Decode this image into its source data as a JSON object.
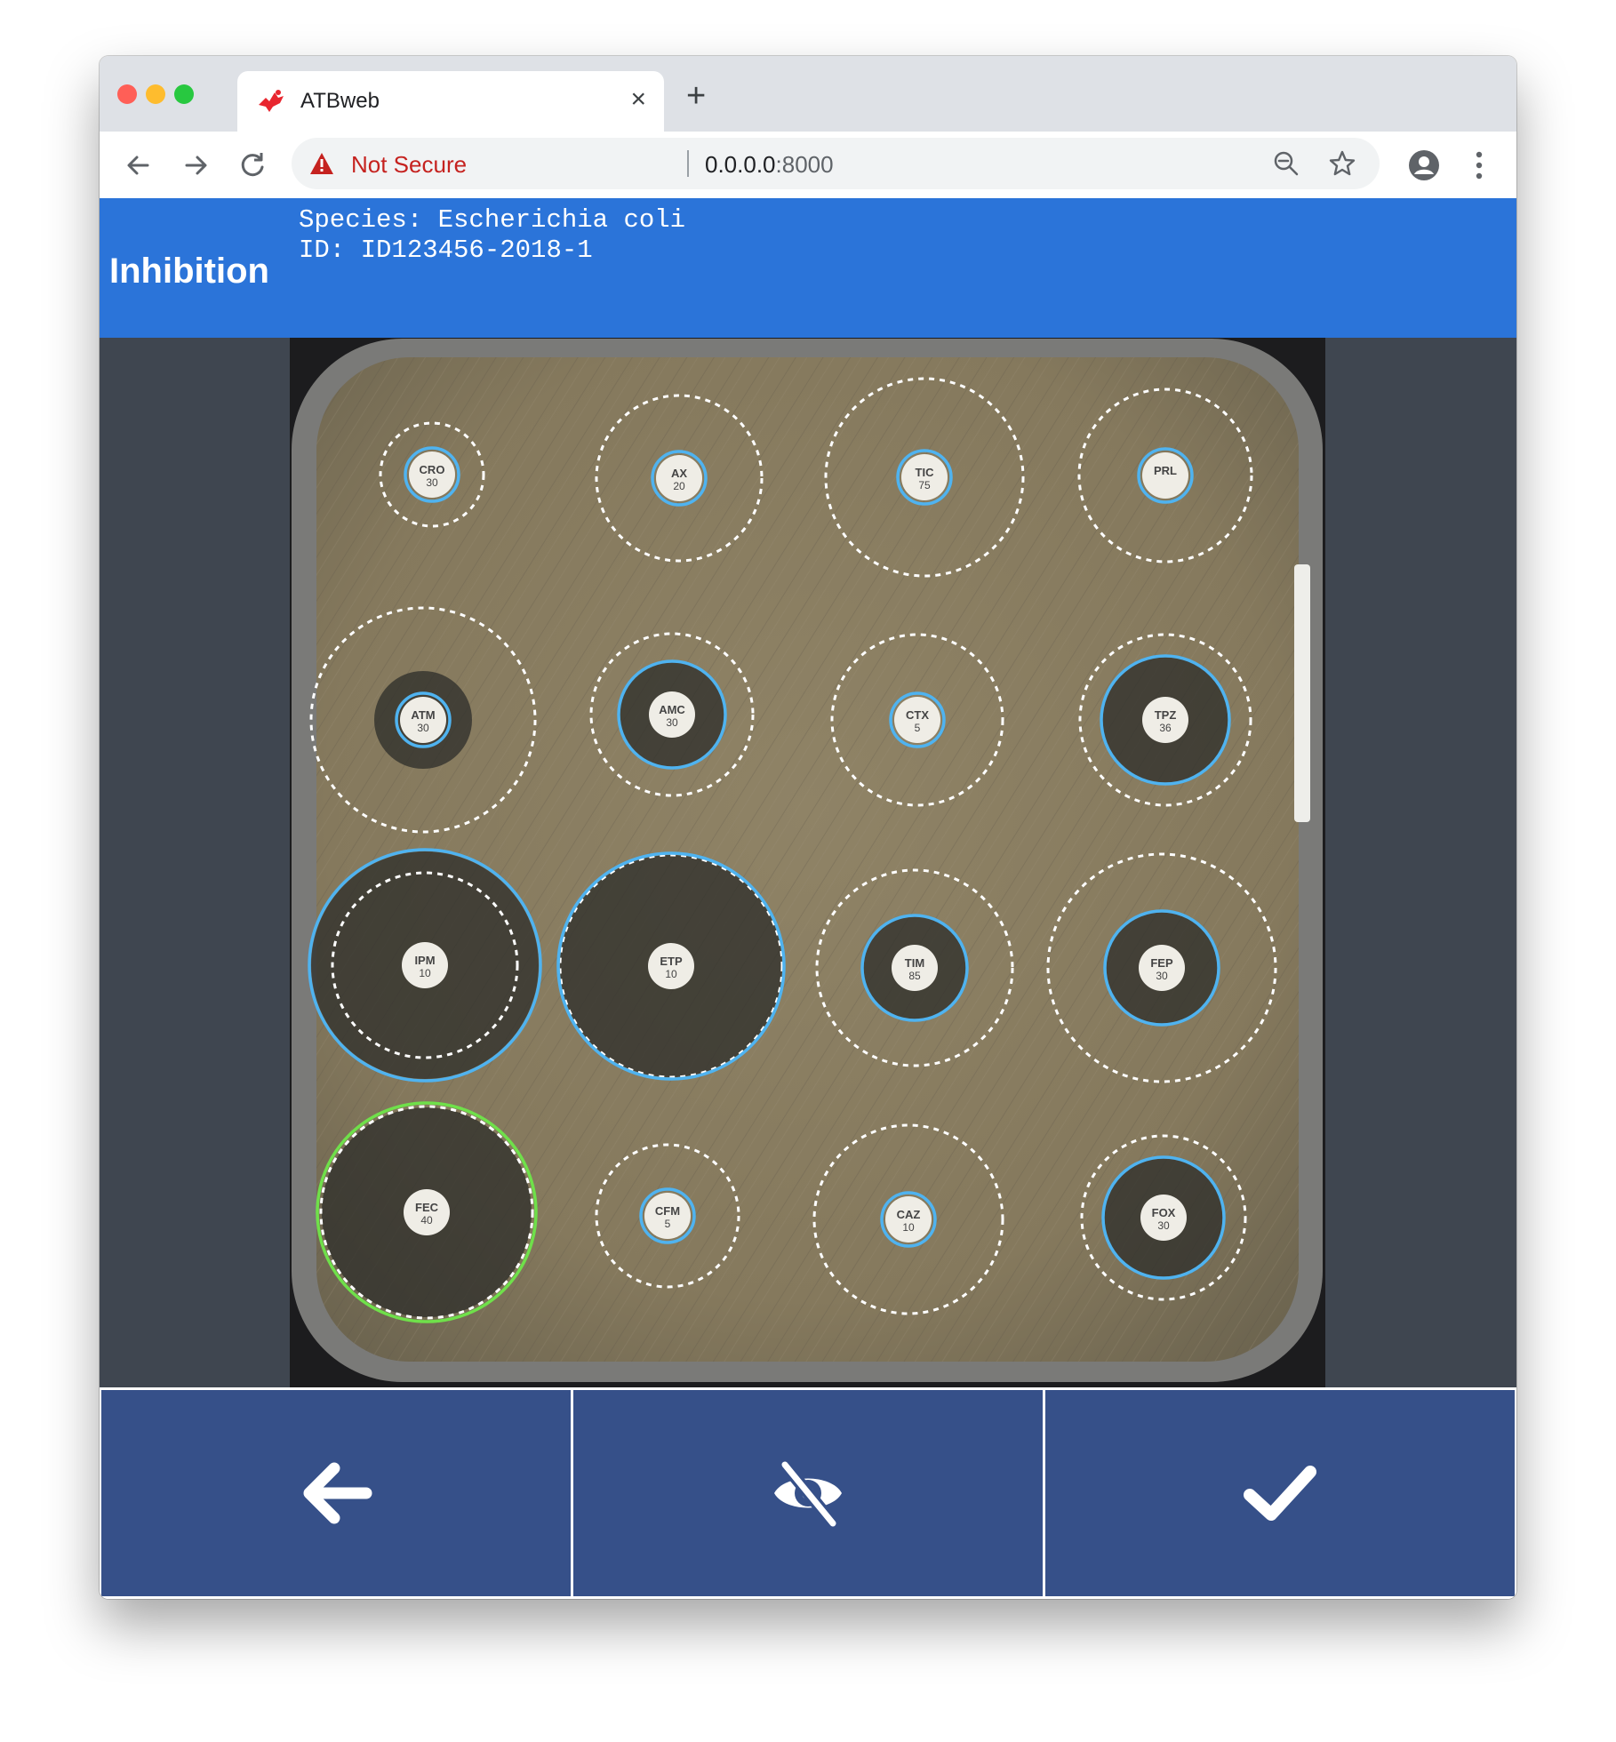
{
  "browser": {
    "tab_title": "ATBweb",
    "tab_close": "×",
    "new_tab": "+",
    "security_label": "Not Secure",
    "url_host": "0.0.0.0",
    "url_port": ":8000"
  },
  "app": {
    "title": "Inhibition",
    "species_line": "Species: Escherichia coli",
    "id_line": "ID: ID123456-2018-1"
  },
  "plate": {
    "disks": [
      {
        "label": "CRO\n30",
        "label_line1": "CRO",
        "label_line2": "30"
      },
      {
        "label": "AX\n20",
        "label_line1": "AX",
        "label_line2": "20"
      },
      {
        "label": "TIC\n75",
        "label_line1": "TIC",
        "label_line2": "75"
      },
      {
        "label": "PRL",
        "label_line1": "PRL",
        "label_line2": ""
      },
      {
        "label": "ATM\n30",
        "label_line1": "ATM",
        "label_line2": "30"
      },
      {
        "label": "AMC\n30",
        "label_line1": "AMC",
        "label_line2": "30"
      },
      {
        "label": "CTX\n5",
        "label_line1": "CTX",
        "label_line2": "5"
      },
      {
        "label": "TPZ\n36",
        "label_line1": "TPZ",
        "label_line2": "36"
      },
      {
        "label": "IPM\n10",
        "label_line1": "IPM",
        "label_line2": "10"
      },
      {
        "label": "ETP\n10",
        "label_line1": "ETP",
        "label_line2": "10"
      },
      {
        "label": "TIM\n85",
        "label_line1": "TIM",
        "label_line2": "85"
      },
      {
        "label": "FEP\n30",
        "label_line1": "FEP",
        "label_line2": "30"
      },
      {
        "label": "FEC\n40",
        "label_line1": "FEC",
        "label_line2": "40"
      },
      {
        "label": "CFM\n5",
        "label_line1": "CFM",
        "label_line2": "5"
      },
      {
        "label": "CAZ\n10",
        "label_line1": "CAZ",
        "label_line2": "10"
      },
      {
        "label": "FOX\n30",
        "label_line1": "FOX",
        "label_line2": "30"
      }
    ],
    "colors": {
      "measured_ring": "#4fb3f0",
      "selected_ring": "#6fe04a",
      "breakpoint_ring": "#ffffff",
      "agar": "#8d7f63",
      "background": "#1c1c1e"
    }
  },
  "actions": {
    "back_icon": "arrow-left-icon",
    "hide_icon": "eye-slash-icon",
    "confirm_icon": "check-icon",
    "button_color": "#365089"
  }
}
